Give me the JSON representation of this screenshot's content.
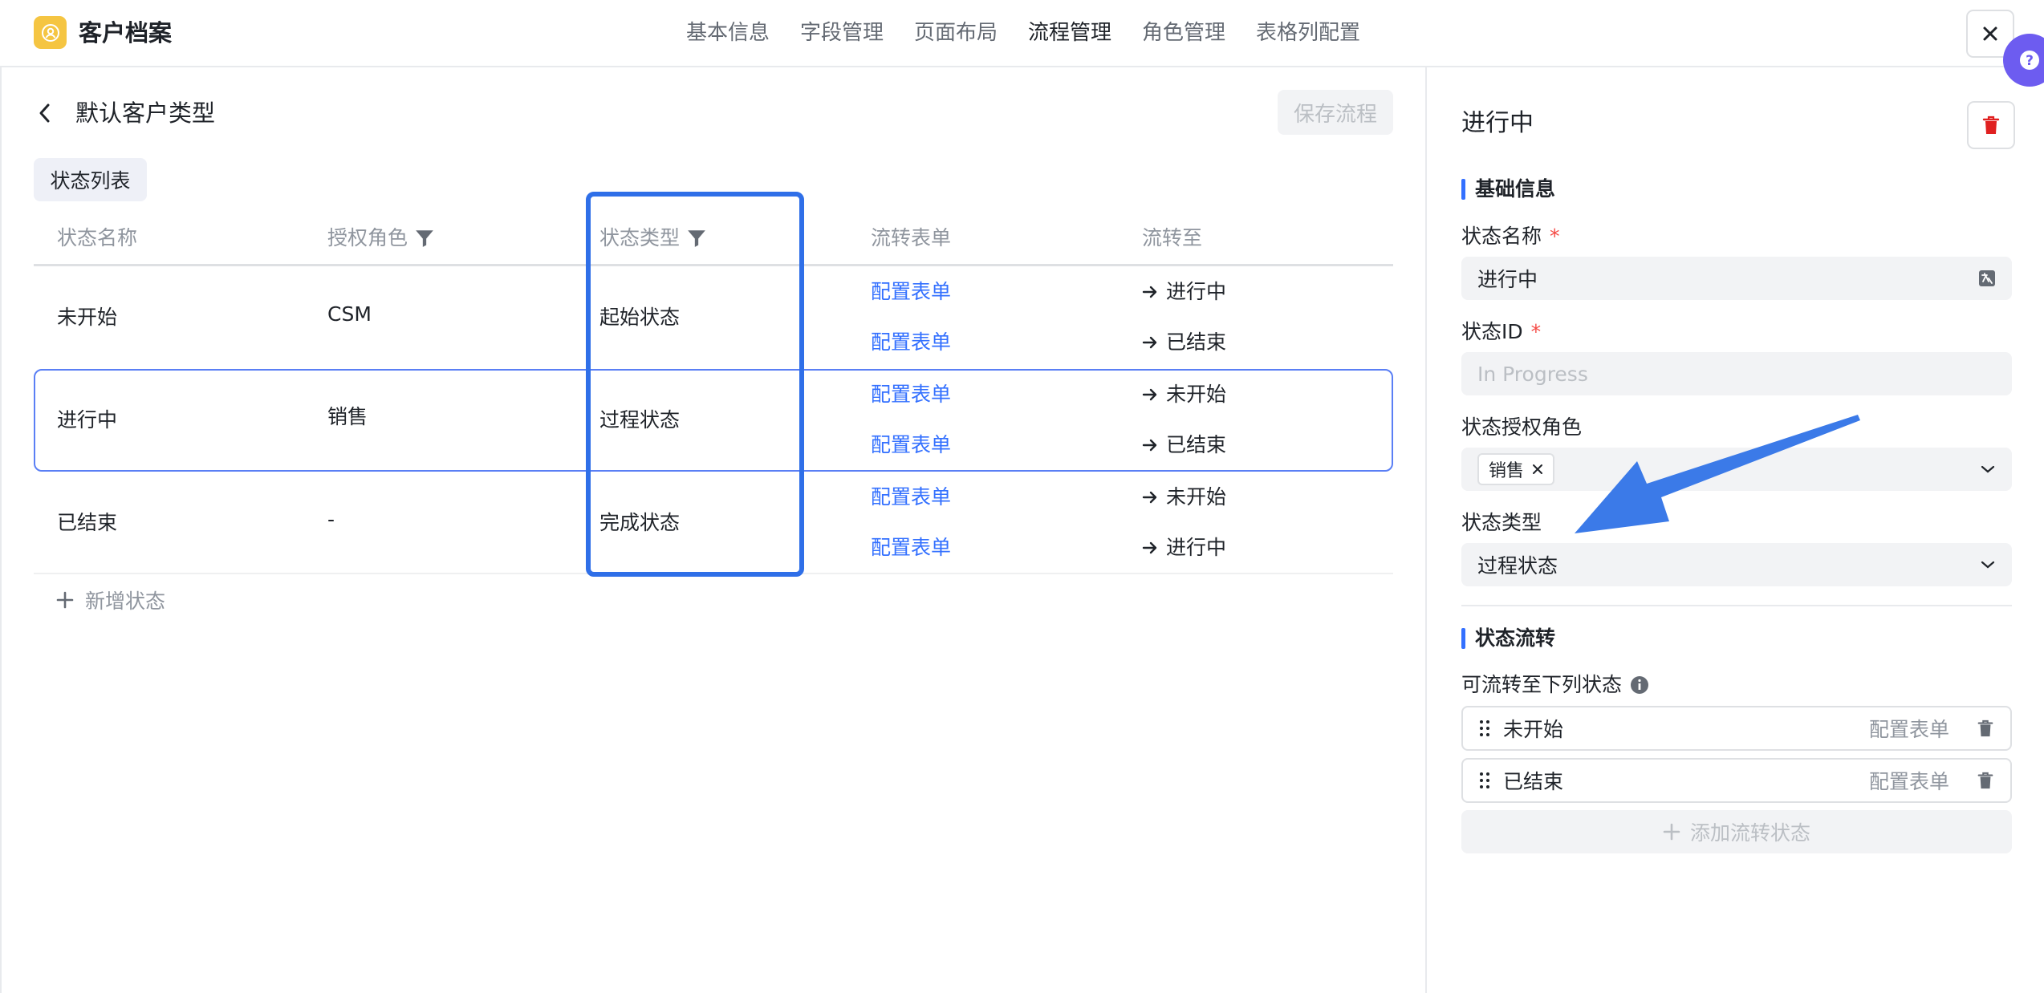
{
  "header": {
    "app_title": "客户档案",
    "tabs": [
      "基本信息",
      "字段管理",
      "页面布局",
      "流程管理",
      "角色管理",
      "表格列配置"
    ],
    "active_tab": "流程管理"
  },
  "left": {
    "back_title": "默认客户类型",
    "save_label": "保存流程",
    "segment_label": "状态列表",
    "columns": [
      "状态名称",
      "授权角色",
      "状态类型",
      "流转表单",
      "流转至"
    ],
    "rows": [
      {
        "name": "未开始",
        "role": "CSM",
        "type": "起始状态",
        "transitions": [
          {
            "form": "配置表单",
            "to": "进行中"
          },
          {
            "form": "配置表单",
            "to": "已结束"
          }
        ]
      },
      {
        "name": "进行中",
        "role": "销售",
        "type": "过程状态",
        "transitions": [
          {
            "form": "配置表单",
            "to": "未开始"
          },
          {
            "form": "配置表单",
            "to": "已结束"
          }
        ]
      },
      {
        "name": "已结束",
        "role": "-",
        "type": "完成状态",
        "transitions": [
          {
            "form": "配置表单",
            "to": "未开始"
          },
          {
            "form": "配置表单",
            "to": "进行中"
          }
        ]
      }
    ],
    "add_state_label": "新增状态"
  },
  "panel": {
    "title": "进行中",
    "section_basic": "基础信息",
    "name_label": "状态名称",
    "name_value": "进行中",
    "id_label": "状态ID",
    "id_placeholder": "In Progress",
    "role_label": "状态授权角色",
    "role_tag": "销售",
    "type_label": "状态类型",
    "type_value": "过程状态",
    "section_flow": "状态流转",
    "flow_label": "可流转至下列状态",
    "flow_items": [
      {
        "name": "未开始",
        "config": "配置表单"
      },
      {
        "name": "已结束",
        "config": "配置表单"
      }
    ],
    "add_flow_label": "添加流转状态"
  },
  "colors": {
    "accent": "#3370ff",
    "highlight_box": "#2f6fe8",
    "annotation_arrow": "#3b7ae8",
    "logo": "#f5c542",
    "help": "#6d5cf0",
    "danger": "#e02020"
  }
}
